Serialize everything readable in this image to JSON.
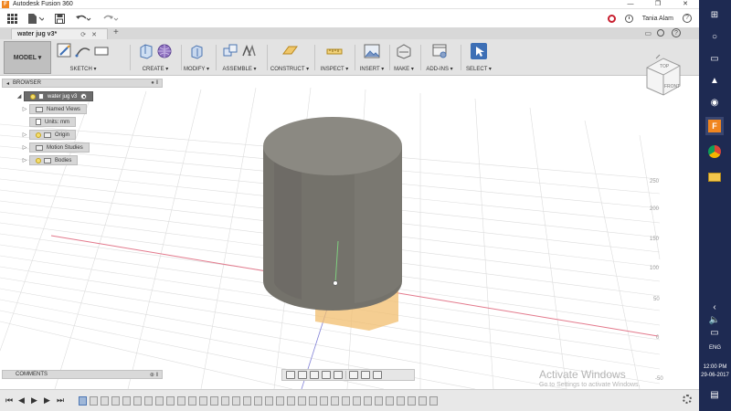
{
  "window": {
    "app_icon": "F",
    "title": "Autodesk Fusion 360",
    "minimize": "—",
    "maximize": "❐",
    "close": "✕"
  },
  "quick_access": {
    "user_name": "Tania Alam",
    "icons": [
      "grid-icon",
      "file-menu-icon",
      "save-icon",
      "undo-icon",
      "redo-icon",
      "record-icon",
      "job-status-icon",
      "help-icon"
    ]
  },
  "doc_tab": {
    "label": "water jug v3*",
    "add": "+"
  },
  "ribbon": {
    "workspace": "MODEL ▾",
    "groups": [
      {
        "label": "SKETCH ▾"
      },
      {
        "label": "CREATE ▾"
      },
      {
        "label": "MODIFY ▾"
      },
      {
        "label": "ASSEMBLE ▾"
      },
      {
        "label": "CONSTRUCT ▾"
      },
      {
        "label": "INSPECT ▾"
      },
      {
        "label": "INSERT ▾"
      },
      {
        "label": "MAKE ▾"
      },
      {
        "label": "ADD-INS ▾"
      },
      {
        "label": "SELECT ▾"
      }
    ],
    "accent": "#3d6fb5"
  },
  "browser": {
    "header": "BROWSER",
    "root": "water jug v3",
    "items": [
      {
        "label": "Named Views"
      },
      {
        "label": "Units: mm"
      },
      {
        "label": "Origin"
      },
      {
        "label": "Motion Studies"
      },
      {
        "label": "Bodies"
      }
    ]
  },
  "comments": {
    "label": "COMMENTS"
  },
  "viewcube": {
    "top": "TOP",
    "front": "FRONT"
  },
  "grid": {
    "y_ticks": [
      "250",
      "200",
      "150",
      "100",
      "50",
      "0",
      "-50"
    ]
  },
  "watermark": {
    "line1": "Activate Windows",
    "line2": "Go to Settings to activate Windows."
  },
  "taskbar": {
    "language": "ENG",
    "time": "12:00 PM",
    "date": "29-06-2017"
  }
}
